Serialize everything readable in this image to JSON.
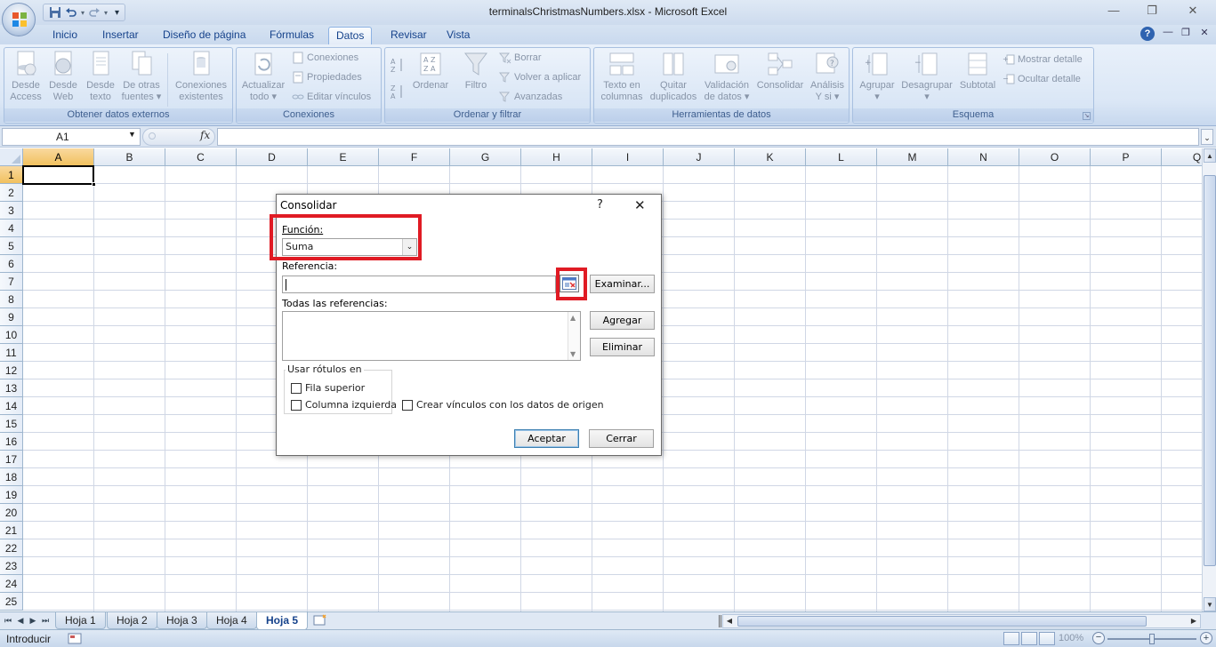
{
  "window": {
    "title": "terminalsChristmasNumbers.xlsx - Microsoft Excel",
    "minimize": "—",
    "restore": "❐",
    "close": "✕"
  },
  "quick_access": {
    "save": "save-icon",
    "undo": "undo-icon",
    "redo": "redo-icon",
    "customize": "▾"
  },
  "tabs": [
    {
      "label": "Inicio"
    },
    {
      "label": "Insertar"
    },
    {
      "label": "Diseño de página"
    },
    {
      "label": "Fórmulas"
    },
    {
      "label": "Datos",
      "active": true
    },
    {
      "label": "Revisar"
    },
    {
      "label": "Vista"
    }
  ],
  "ribbon_right": {
    "help": "?",
    "min": "—",
    "restore": "❐",
    "close": "✕"
  },
  "ribbon": {
    "groups": [
      {
        "label": "Obtener datos externos",
        "buttons": [
          {
            "line1": "Desde",
            "line2": "Access"
          },
          {
            "line1": "Desde",
            "line2": "Web"
          },
          {
            "line1": "Desde",
            "line2": "texto"
          },
          {
            "line1": "De otras",
            "line2": "fuentes ▾"
          },
          {
            "line1": "Conexiones",
            "line2": "existentes"
          }
        ]
      },
      {
        "label": "Conexiones",
        "big": {
          "line1": "Actualizar",
          "line2": "todo ▾"
        },
        "small": [
          "Conexiones",
          "Propiedades",
          "Editar vínculos"
        ]
      },
      {
        "label": "Ordenar y filtrar",
        "sort_label": "Ordenar",
        "filter_label": "Filtro",
        "small": [
          "Borrar",
          "Volver a aplicar",
          "Avanzadas"
        ]
      },
      {
        "label": "Herramientas de datos",
        "buttons": [
          {
            "line1": "Texto en",
            "line2": "columnas"
          },
          {
            "line1": "Quitar",
            "line2": "duplicados"
          },
          {
            "line1": "Validación",
            "line2": "de datos ▾"
          },
          {
            "line1": "Consolidar",
            "line2": ""
          },
          {
            "line1": "Análisis",
            "line2": "Y si ▾"
          }
        ]
      },
      {
        "label": "Esquema",
        "buttons": [
          {
            "line1": "Agrupar",
            "line2": "▾"
          },
          {
            "line1": "Desagrupar",
            "line2": "▾"
          },
          {
            "line1": "Subtotal",
            "line2": ""
          }
        ],
        "small": [
          "Mostrar detalle",
          "Ocultar detalle"
        ]
      }
    ]
  },
  "formula_bar": {
    "name_box": "A1",
    "fx": "fx",
    "formula": ""
  },
  "grid": {
    "columns": [
      "A",
      "B",
      "C",
      "D",
      "E",
      "F",
      "G",
      "H",
      "I",
      "J",
      "K",
      "L",
      "M",
      "N",
      "O",
      "P",
      "Q"
    ],
    "rows": [
      "1",
      "2",
      "3",
      "4",
      "5",
      "6",
      "7",
      "8",
      "9",
      "10",
      "11",
      "12",
      "13",
      "14",
      "15",
      "16",
      "17",
      "18",
      "19",
      "20",
      "21",
      "22",
      "23",
      "24",
      "25"
    ],
    "active_cell": "A1"
  },
  "sheets": {
    "tabs": [
      "Hoja 1",
      "Hoja 2",
      "Hoja 3",
      "Hoja 4",
      "Hoja 5"
    ],
    "active": "Hoja 5"
  },
  "status": {
    "mode": "Introducir",
    "zoom": "100%",
    "zoom_minus": "−",
    "zoom_plus": "+"
  },
  "dialog": {
    "title": "Consolidar",
    "help": "?",
    "close": "✕",
    "function_label": "Función:",
    "function_value": "Suma",
    "reference_label": "Referencia:",
    "reference_value": "",
    "browse_label": "Examinar...",
    "all_refs_label": "Todas las referencias:",
    "add_label": "Agregar",
    "delete_label": "Eliminar",
    "use_labels_legend": "Usar rótulos en",
    "top_row_label": "Fila superior",
    "left_col_label": "Columna izquierda",
    "links_label": "Crear vínculos con los datos de origen",
    "top_row_checked": false,
    "left_col_checked": false,
    "links_checked": false,
    "ok_label": "Aceptar",
    "close_label": "Cerrar",
    "highlight_color": "#e01b24"
  }
}
